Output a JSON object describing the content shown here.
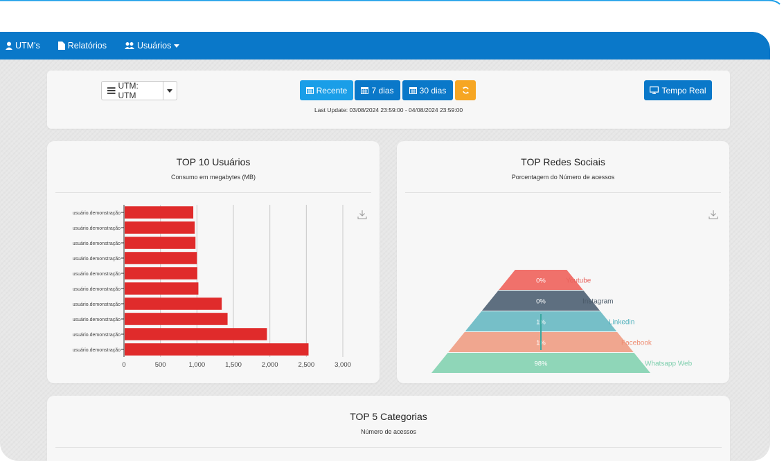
{
  "nav": {
    "utms": "UTM's",
    "relatorios": "Relatórios",
    "usuarios": "Usuários"
  },
  "toolbar": {
    "utm_select": "UTM: UTM",
    "btn_recente": "Recente",
    "btn_7dias": "7 dias",
    "btn_30dias": "30 dias",
    "btn_tempo_real": "Tempo Real",
    "last_update": "Last Update: 03/08/2024 23:59:00 - 04/08/2024 23:59:00"
  },
  "colors": {
    "nav_blue": "#0a78c9",
    "active_blue": "#1a9ee8",
    "orange": "#f6a623",
    "bar_red": "#e02b2b"
  },
  "icons": [
    "user-icon",
    "file-icon",
    "users-icon",
    "caret-down-icon",
    "list-icon",
    "calendar-icon",
    "refresh-icon",
    "monitor-icon",
    "download-icon"
  ],
  "chart_data": [
    {
      "type": "bar",
      "orientation": "horizontal",
      "title": "TOP 10 Usuários",
      "subtitle": "Consumo em megabytes (MB)",
      "categories": [
        "usuário.demonstração",
        "usuário.demonstração",
        "usuário.demonstração",
        "usuário.demonstração",
        "usuário.demonstração",
        "usuário.demonstração",
        "usuário.demonstração",
        "usuário.demonstração",
        "usuário.demonstração",
        "usuário.demonstração"
      ],
      "values": [
        950,
        970,
        980,
        1000,
        1005,
        1020,
        1340,
        1420,
        1960,
        2530
      ],
      "xlim": [
        0,
        3000
      ],
      "xticks": [
        "0",
        "500",
        "1,000",
        "1,500",
        "2,000",
        "2,500",
        "3,000"
      ],
      "grid": true
    },
    {
      "type": "funnel",
      "title": "TOP Redes Sociais",
      "subtitle": "Porcentagem do Número de acessos",
      "categories": [
        "Youtube",
        "Instagram",
        "Linkedin",
        "Facebook",
        "Whatsapp Web"
      ],
      "values": [
        0,
        0,
        1,
        1,
        98
      ],
      "labels": [
        "0%",
        "0%",
        "1%",
        "1%",
        "98%"
      ],
      "colors": [
        "#f0716b",
        "#5e6f80",
        "#76bfc8",
        "#f0a68f",
        "#8fd6b8"
      ]
    },
    {
      "type": "bar",
      "title": "TOP 5 Categorias",
      "subtitle": "Número de acessos"
    }
  ]
}
